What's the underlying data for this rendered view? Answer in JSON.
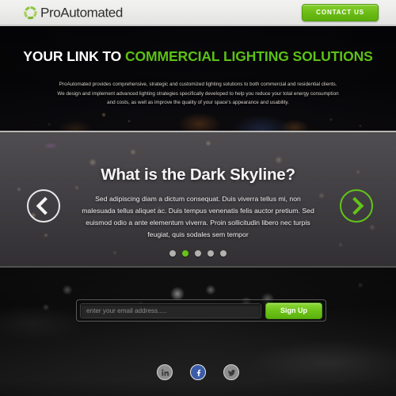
{
  "header": {
    "logo_icon": "circular-ring-logo",
    "logo_text": "ProAutomated",
    "contact_label": "CONTACT US"
  },
  "hero": {
    "headline_white": "YOUR LINK TO",
    "headline_green": "COMMERCIAL LIGHTING SOLUTIONS",
    "paragraph": "ProAutomated provides comprehensive, strategic and customized lighting solutions to both commercial and residential clients. We design and implement advanced lighting strategies specifically developed to help you reduce your total energy consumption and costs, as well as improve the quality of your space's appearance and usability."
  },
  "slider": {
    "title": "What is the Dark Skyline?",
    "body": "Sed adipiscing diam a dictum consequat. Duis viverra tellus mi, non malesuada tellus aliquet ac. Duis tempus venenatis felis auctor pretium. Sed euismod odio a ante elementum viverra. Proin sollicitudin libero nec turpis feugiat, quis sodales sem tempor",
    "prev_icon": "chevron-left-icon",
    "next_icon": "chevron-right-icon",
    "dots": [
      {
        "active": false
      },
      {
        "active": true
      },
      {
        "active": false
      },
      {
        "active": false
      },
      {
        "active": false
      }
    ]
  },
  "signup": {
    "email_placeholder": "enter your email address.....",
    "email_value": "",
    "button_label": "Sign Up",
    "socials": [
      {
        "name": "linkedin-icon",
        "glyph": "in",
        "style": "gray"
      },
      {
        "name": "facebook-icon",
        "glyph": "f",
        "style": "fb"
      },
      {
        "name": "twitter-icon",
        "glyph": "t",
        "style": "gray"
      }
    ]
  },
  "colors": {
    "brand_green": "#5cc115",
    "button_green": "#6ec318",
    "facebook_blue": "#3b5ca8",
    "header_bg": "#ececeb",
    "dot_inactive": "#b2b2b0"
  }
}
